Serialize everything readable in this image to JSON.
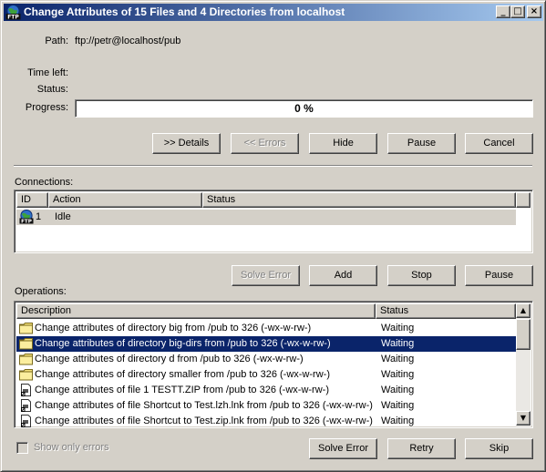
{
  "window": {
    "title": "Change Attributes of 15 Files and 4 Directories from localhost",
    "minimize_glyph": "_",
    "maximize_glyph": "□",
    "close_glyph": "×"
  },
  "info": {
    "path_label": "Path:",
    "path_value": "ftp://petr@localhost/pub",
    "time_left_label": "Time left:",
    "status_label": "Status:",
    "progress_label": "Progress:",
    "progress_text": "0 %",
    "progress_value": 0
  },
  "top_buttons": {
    "details": ">> Details",
    "errors": "<< Errors",
    "hide": "Hide",
    "pause": "Pause",
    "cancel": "Cancel"
  },
  "connections": {
    "label": "Connections:",
    "columns": [
      "ID",
      "Action",
      "Status"
    ],
    "rows": [
      {
        "id": "1",
        "action": "Idle",
        "status": "",
        "icon": "ftp-globe-icon"
      }
    ]
  },
  "connection_buttons": {
    "solve_error": "Solve Error",
    "add": "Add",
    "stop": "Stop",
    "pause": "Pause"
  },
  "operations": {
    "label": "Operations:",
    "columns": [
      "Description",
      "Status"
    ],
    "rows": [
      {
        "description": "Change attributes of directory big from /pub to 326 (-wx-w-rw-)",
        "status": "Waiting",
        "icon": "folder-icon"
      },
      {
        "description": "Change attributes of directory big-dirs from /pub to 326 (-wx-w-rw-)",
        "status": "Waiting",
        "icon": "folder-icon",
        "selected": true
      },
      {
        "description": "Change attributes of directory d from /pub to 326 (-wx-w-rw-)",
        "status": "Waiting",
        "icon": "folder-icon"
      },
      {
        "description": "Change attributes of directory smaller from /pub to 326 (-wx-w-rw-)",
        "status": "Waiting",
        "icon": "folder-icon"
      },
      {
        "description": "Change attributes of file 1 TESTT.ZIP from /pub to 326 (-wx-w-rw-)",
        "status": "Waiting",
        "icon": "file-shortcut-icon"
      },
      {
        "description": "Change attributes of file Shortcut to Test.lzh.lnk from /pub to 326 (-wx-w-rw-)",
        "status": "Waiting",
        "icon": "file-shortcut-icon"
      },
      {
        "description": "Change attributes of file Shortcut to Test.zip.lnk from /pub to 326 (-wx-w-rw-)",
        "status": "Waiting",
        "icon": "file-shortcut-icon"
      }
    ]
  },
  "bottom": {
    "show_only_errors": "Show only errors",
    "show_only_errors_checked": false,
    "solve_error": "Solve Error",
    "retry": "Retry",
    "skip": "Skip"
  },
  "colors": {
    "title_start": "#0a246a",
    "title_end": "#a6caf0",
    "face": "#d4d0c8",
    "selection": "#0a246a"
  }
}
